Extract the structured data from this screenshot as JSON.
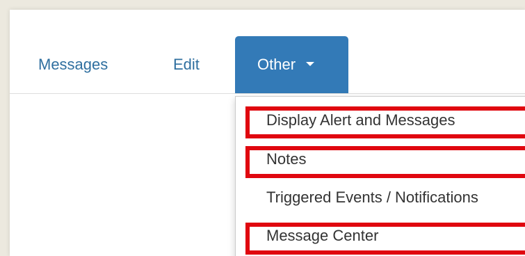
{
  "nav": {
    "tabs": {
      "messages": "Messages",
      "edit": "Edit",
      "other": "Other"
    }
  },
  "dropdown": {
    "items": [
      "Display Alert and Messages",
      "Notes",
      "Triggered Events / Notifications",
      "Message Center"
    ],
    "highlighted": [
      "Display Alert and Messages",
      "Notes",
      "Message Center"
    ]
  },
  "icons": {
    "other_caret": "chevron-down-icon"
  },
  "colors": {
    "active_tab": "#337ab7",
    "link_text": "#2f6f9f",
    "highlight_border": "#e0070f",
    "menu_text": "#333333"
  }
}
